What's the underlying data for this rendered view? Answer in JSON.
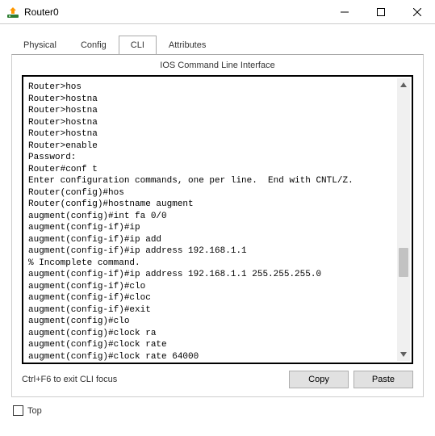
{
  "window": {
    "title": "Router0"
  },
  "tabs": {
    "physical": "Physical",
    "config": "Config",
    "cli": "CLI",
    "attributes": "Attributes"
  },
  "panel": {
    "heading": "IOS Command Line Interface",
    "hint": "Ctrl+F6 to exit CLI focus",
    "copy": "Copy",
    "paste": "Paste"
  },
  "bottom": {
    "top_label": "Top"
  },
  "cli_lines": [
    "Router>hos",
    "Router>hostna",
    "Router>hostna",
    "Router>hostna",
    "Router>hostna",
    "Router>enable",
    "Password:",
    "Router#conf t",
    "Enter configuration commands, one per line.  End with CNTL/Z.",
    "Router(config)#hos",
    "Router(config)#hostname augment",
    "augment(config)#int fa 0/0",
    "augment(config-if)#ip",
    "augment(config-if)#ip add",
    "augment(config-if)#ip address 192.168.1.1",
    "% Incomplete command.",
    "augment(config-if)#ip address 192.168.1.1 255.255.255.0",
    "augment(config-if)#clo",
    "augment(config-if)#cloc",
    "augment(config-if)#exit",
    "augment(config)#clo",
    "augment(config)#clock ra",
    "augment(config)#clock rate",
    "augment(config)#clock rate 64000"
  ]
}
